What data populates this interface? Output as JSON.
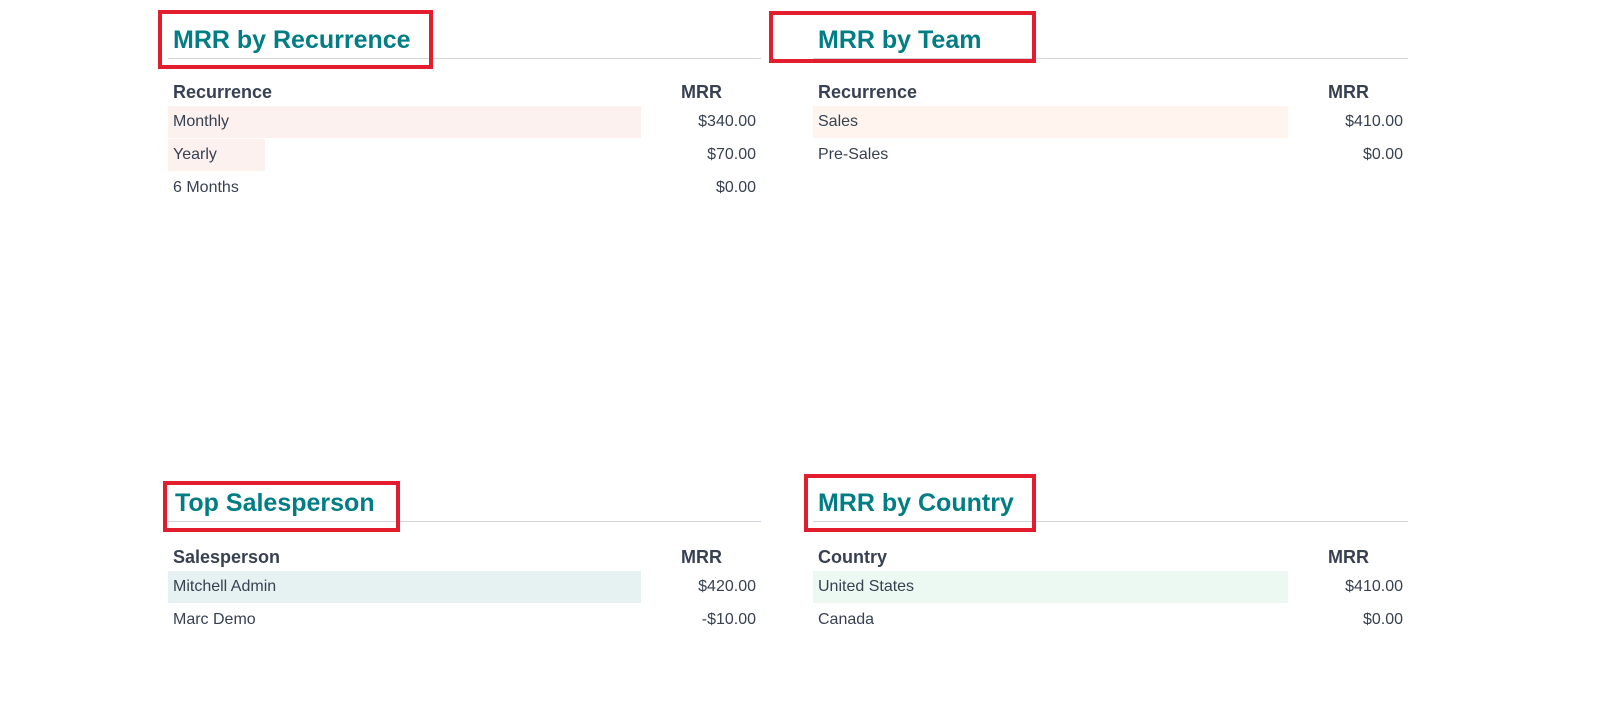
{
  "panels": [
    {
      "title": "MRR by Recurrence",
      "col_label": "Recurrence",
      "col_value": "MRR",
      "bar_color": "#fdf1f0",
      "rows": [
        {
          "label": "Monthly",
          "value": "$340.00",
          "share": 1.0
        },
        {
          "label": "Yearly",
          "value": "$70.00",
          "share": 0.206
        },
        {
          "label": "6 Months",
          "value": "$0.00",
          "share": 0
        }
      ]
    },
    {
      "title": "MRR by Team",
      "col_label": "Recurrence",
      "col_value": "MRR",
      "bar_color": "#fff5ee",
      "rows": [
        {
          "label": "Sales",
          "value": "$410.00",
          "share": 1.0
        },
        {
          "label": "Pre-Sales",
          "value": "$0.00",
          "share": 0
        }
      ]
    },
    {
      "title": "Top Salesperson",
      "col_label": "Salesperson",
      "col_value": "MRR",
      "bar_color": "#e6f2f2",
      "rows": [
        {
          "label": "Mitchell Admin",
          "value": "$420.00",
          "share": 1.0
        },
        {
          "label": "Marc Demo",
          "value": "-$10.00",
          "share": 0
        }
      ]
    },
    {
      "title": "MRR by Country",
      "col_label": "Country",
      "col_value": "MRR",
      "bar_color": "#ecf9f3",
      "rows": [
        {
          "label": "United States",
          "value": "$410.00",
          "share": 1.0
        },
        {
          "label": "Canada",
          "value": "$0.00",
          "share": 0
        }
      ]
    }
  ],
  "highlight_color": "#e21d2d",
  "title_color": "#017e84"
}
